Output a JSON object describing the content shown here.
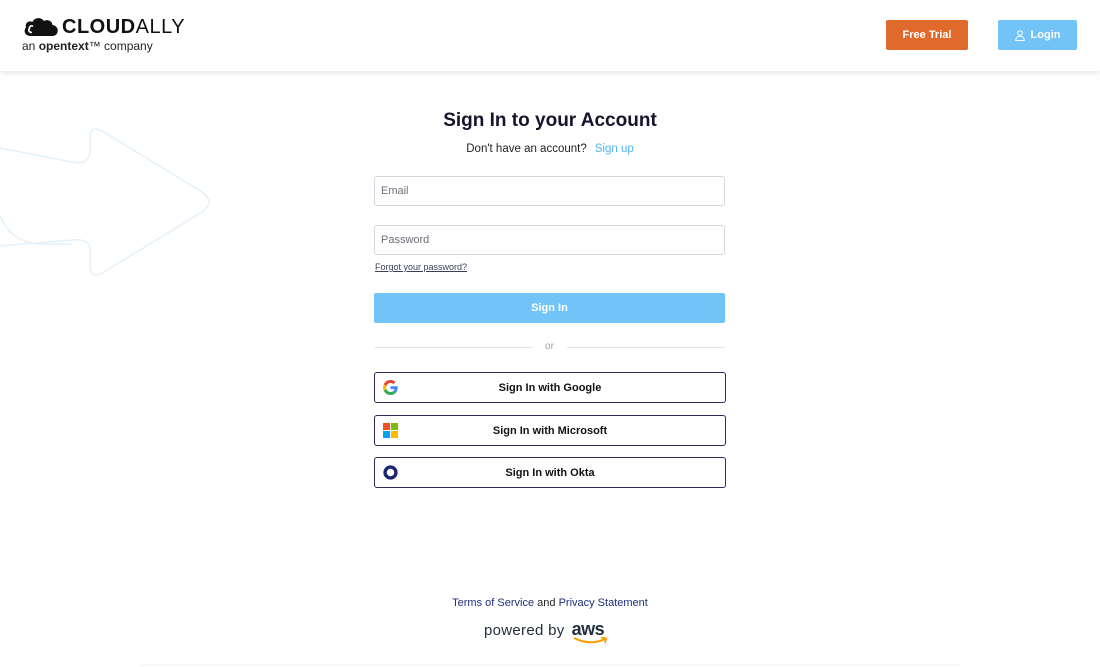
{
  "brand": {
    "name_bold": "CLOUD",
    "name_light": "ALLY",
    "tagline_prefix": "an ",
    "tagline_brand": "opentext",
    "tagline_suffix": "™ company"
  },
  "header": {
    "free_trial_label": "Free Trial",
    "login_label": "Login"
  },
  "form": {
    "title": "Sign In to your Account",
    "no_account_text": "Don't have an account?",
    "signup_link": "Sign up",
    "email_placeholder": "Email",
    "password_placeholder": "Password",
    "forgot_link": "Forgot your password?",
    "signin_label": "Sign In",
    "or_text": "or"
  },
  "sso": {
    "google_label": "Sign In with Google",
    "microsoft_label": "Sign In with Microsoft",
    "okta_label": "Sign In with Okta"
  },
  "footer": {
    "terms_link": "Terms of Service",
    "and_text": "and",
    "privacy_link": "Privacy Statement",
    "powered_by": "powered by",
    "aws_text": "aws"
  },
  "colors": {
    "accent_orange": "#e06a2b",
    "accent_blue": "#72c3f7",
    "link_blue": "#53b3f3",
    "border_navy": "#2b2c5a"
  },
  "icons": {
    "logo": "cloud-logo-icon",
    "login": "user-icon",
    "google": "google-icon",
    "microsoft": "microsoft-icon",
    "okta": "okta-icon",
    "aws_smile": "aws-smile-icon",
    "decoration": "arrow-outline-decoration"
  }
}
